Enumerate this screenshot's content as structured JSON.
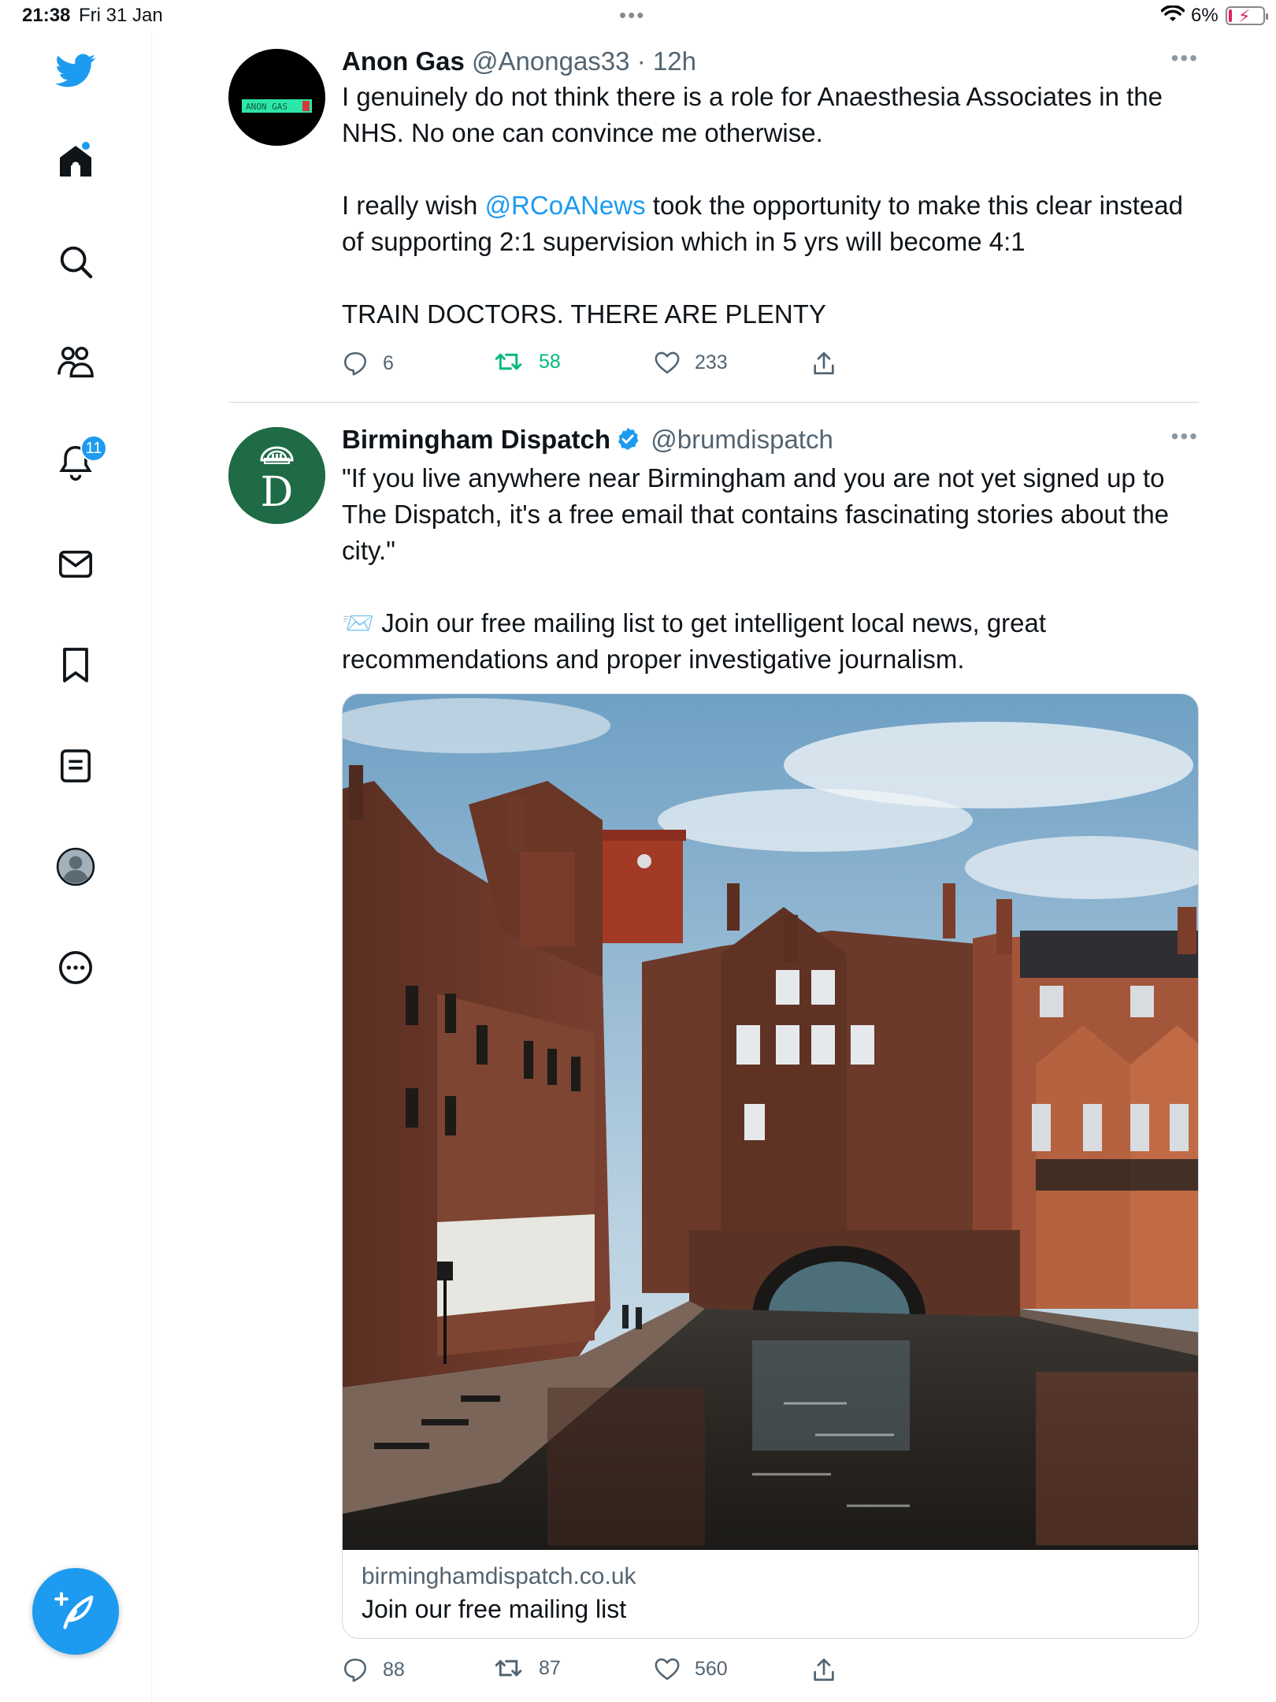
{
  "status_bar": {
    "time": "21:38",
    "date": "Fri 31 Jan",
    "battery_pct": "6%"
  },
  "sidebar": {
    "items": [
      {
        "name": "twitter-logo",
        "icon": "twitter-bird-icon"
      },
      {
        "name": "home",
        "icon": "home-icon"
      },
      {
        "name": "explore",
        "icon": "search-icon"
      },
      {
        "name": "communities",
        "icon": "people-icon"
      },
      {
        "name": "notifications",
        "icon": "bell-icon",
        "badge": "11"
      },
      {
        "name": "messages",
        "icon": "envelope-icon"
      },
      {
        "name": "bookmarks",
        "icon": "bookmark-icon"
      },
      {
        "name": "lists",
        "icon": "list-icon"
      },
      {
        "name": "profile",
        "icon": "avatar-icon"
      },
      {
        "name": "more",
        "icon": "more-circle-icon"
      }
    ],
    "compose_icon": "compose-feather-icon"
  },
  "tweets": [
    {
      "name": "Anon Gas",
      "handle": "@Anongas33",
      "sep": "·",
      "time": "12h",
      "avatar_text": "ANON GAS",
      "text_lines": [
        "I genuinely do not think there is a role for Anaesthesia Associates in the NHS. No one can convince me otherwise."
      ],
      "text_p2_before": "I really wish ",
      "text_p2_mention": "@RCoANews",
      "text_p2_after": " took the opportunity to make this clear instead of supporting 2:1 supervision which in 5 yrs will become 4:1",
      "text_p3": "TRAIN DOCTORS. THERE ARE PLENTY",
      "replies": "6",
      "retweets": "58",
      "likes": "233"
    },
    {
      "name": "Birmingham Dispatch",
      "handle": "@brumdispatch",
      "avatar_text": "D",
      "text_p1": "\"If you live anywhere near Birmingham and you are not yet signed up to The Dispatch, it's a free email that contains fascinating stories about the city.\"",
      "text_p2_emoji": "📨",
      "text_p2": " Join our free mailing list to get intelligent local news, great recommendations and proper investigative journalism.",
      "card": {
        "domain": "birminghamdispatch.co.uk",
        "title": "Join our free mailing list"
      },
      "replies": "88",
      "retweets": "87",
      "likes": "560"
    }
  ],
  "colors": {
    "accent": "#1d9bf0",
    "retweet_active": "#00ba7c",
    "secondary_text": "#536471",
    "dispatch_green": "#1e6b45"
  }
}
